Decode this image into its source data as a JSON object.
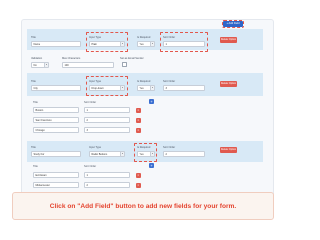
{
  "toolbar": {
    "add_field_label": "+ Add Field"
  },
  "labels": {
    "title": "Title",
    "input_type": "Input Type",
    "is_required": "Is Required",
    "sort_order": "Sort Order",
    "validation": "Validation",
    "max_characters": "Max Characters",
    "set_as_email_sender": "Set as Email Sender",
    "delete_option": "Delete Option"
  },
  "fields": [
    {
      "title": "Name",
      "input_type": "Plain",
      "is_required": "Yes",
      "sort_order": "1",
      "validation": "No",
      "max_characters": "100"
    },
    {
      "title": "City",
      "input_type": "Drop-down",
      "is_required": "Yes",
      "sort_order": "3",
      "options": [
        {
          "title": "Boston",
          "sort": "1"
        },
        {
          "title": "San Francisco",
          "sort": "2"
        },
        {
          "title": "Chicago",
          "sort": "3"
        }
      ]
    },
    {
      "title": "Study For",
      "input_type": "Radio Buttons",
      "is_required": "Yes",
      "sort_order": "2",
      "options": [
        {
          "title": "Exit Exam",
          "sort": "1"
        },
        {
          "title": "Midsemester",
          "sort": "2"
        }
      ]
    }
  ],
  "banner": {
    "text": "Click on \"Add Field\" button to add new fields for your form."
  },
  "colors": {
    "accent_blue": "#2f66c8",
    "danger_red": "#e05a4f",
    "band_blue": "#d8e9f6",
    "banner_text": "#e4442f"
  }
}
